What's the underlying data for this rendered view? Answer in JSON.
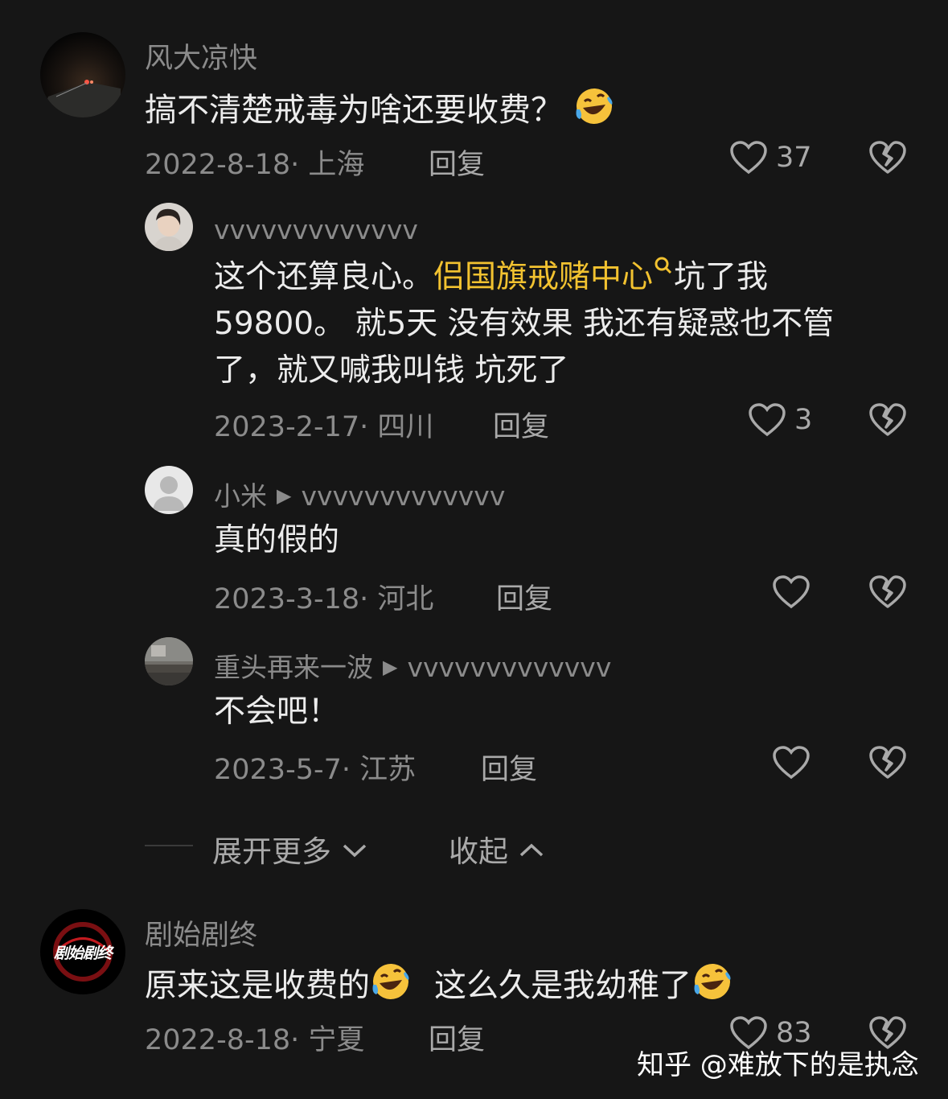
{
  "comments": [
    {
      "user": "风大凉快",
      "text": "搞不清楚戒毒为啥还要收费？",
      "date": "2022-8-18",
      "location": "上海",
      "reply_label": "回复",
      "likes": "37",
      "emoji": "rofl-emoji"
    },
    {
      "user": "剧始剧终",
      "text_a": "原来这是收费的",
      "text_b": "这么久是我幼稚了",
      "date": "2022-8-18",
      "location": "宁夏",
      "reply_label": "回复",
      "likes": "83",
      "avatar_text": "剧始剧终"
    }
  ],
  "replies": [
    {
      "user": "vvvvvvvvvvvvv",
      "text_before": "这个还算良心。",
      "tag": "侣国旗戒赌中心",
      "text_after": "坑了我59800。 就5天 没有效果 我还有疑惑也不管了，就又喊我叫钱 坑死了",
      "date": "2023-2-17",
      "location": "四川",
      "reply_label": "回复",
      "likes": "3"
    },
    {
      "user": "小米",
      "reply_to": "vvvvvvvvvvvvv",
      "text": "真的假的",
      "date": "2023-3-18",
      "location": "河北",
      "reply_label": "回复"
    },
    {
      "user": "重头再来一波",
      "reply_to": "vvvvvvvvvvvvv",
      "text": "不会吧！",
      "date": "2023-5-7",
      "location": "江苏",
      "reply_label": "回复"
    }
  ],
  "thread_controls": {
    "expand_label": "展开更多",
    "collapse_label": "收起"
  },
  "watermark": "知乎 @难放下的是执念",
  "colors": {
    "background": "#161616",
    "highlight_tag": "#f2c230",
    "muted_text": "#8b8b8b"
  }
}
